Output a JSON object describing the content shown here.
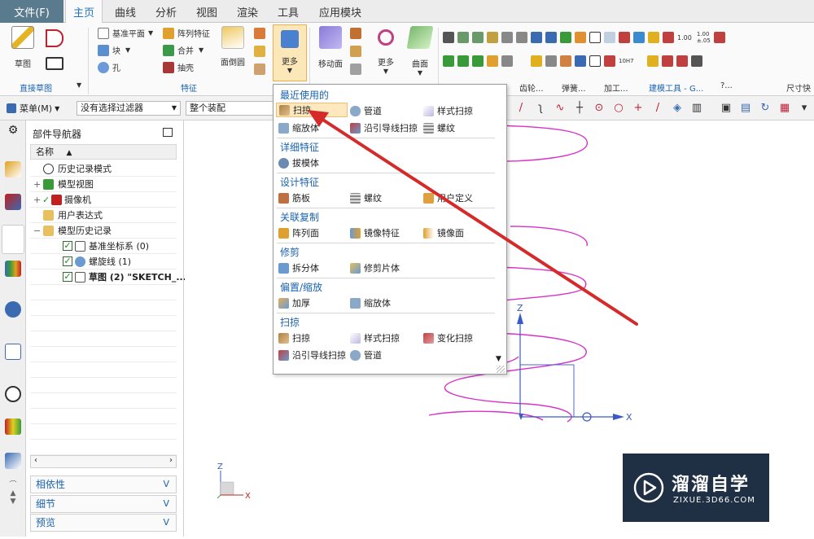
{
  "menubar": {
    "file": "文件(F)",
    "tabs": [
      "主页",
      "曲线",
      "分析",
      "视图",
      "渲染",
      "工具",
      "应用模块"
    ],
    "active_tab": "主页"
  },
  "ribbon": {
    "sketch": "草图",
    "datum_plane": "基准平面",
    "pattern_feature": "阵列特征",
    "block": "块",
    "unite": "合并",
    "hole": "孔",
    "shell": "抽壳",
    "face_blend": "面倒圆",
    "more": "更多",
    "move_face": "移动面",
    "more2": "更多",
    "surface": "曲面",
    "group_direct_sketch": "直接草图",
    "group_feature": "特征",
    "tools": [
      "齿轮...",
      "弹簧...",
      "加工...",
      "建模工具 - G...",
      "?..."
    ],
    "dimension_label": "尺寸快",
    "dim_val1": "1.00",
    "dim_val2a": "1.00",
    "dim_val2b": "±.05",
    "dim_h7": "10H7"
  },
  "toolbar": {
    "menu": "菜单(M)",
    "filter": "没有选择过滤器",
    "scope": "整个装配"
  },
  "navigator": {
    "title": "部件导航器",
    "column_name": "名称",
    "rows": [
      {
        "label": "历史记录模式"
      },
      {
        "label": "模型视图"
      },
      {
        "label": "摄像机"
      },
      {
        "label": "用户表达式"
      },
      {
        "label": "模型历史记录"
      },
      {
        "label": "基准坐标系 (0)"
      },
      {
        "label": "螺旋线 (1)"
      },
      {
        "label": "草图 (2) \"SKETCH_..."
      }
    ],
    "panels": [
      "相依性",
      "细节",
      "预览"
    ]
  },
  "dropdown": {
    "sections": [
      {
        "heading": "最近使用的",
        "items": [
          "扫掠",
          "管道",
          "样式扫掠",
          "缩放体",
          "沿引导线扫掠",
          "螺纹"
        ]
      },
      {
        "heading": "详细特征",
        "items": [
          "拔模体"
        ]
      },
      {
        "heading": "设计特征",
        "items": [
          "筋板",
          "螺纹",
          "用户定义"
        ]
      },
      {
        "heading": "关联复制",
        "items": [
          "阵列面",
          "镜像特征",
          "镜像面"
        ]
      },
      {
        "heading": "修剪",
        "items": [
          "拆分体",
          "修剪片体"
        ]
      },
      {
        "heading": "偏置/缩放",
        "items": [
          "加厚",
          "缩放体"
        ]
      },
      {
        "heading": "扫掠",
        "items": [
          "扫掠",
          "样式扫掠",
          "变化扫掠",
          "沿引导线扫掠",
          "管道"
        ]
      }
    ]
  },
  "viewport": {
    "axis_z": "Z",
    "axis_x": "X",
    "triad_z": "Z",
    "triad_x": "X"
  },
  "watermark": {
    "name": "溜溜自学",
    "url": "ZIXUE.3D66.COM"
  },
  "colors": {
    "accent": "#1a63b0",
    "helix": "#d633c8",
    "arrow": "#d42a2a",
    "file_menu": "#5a7a8e"
  }
}
